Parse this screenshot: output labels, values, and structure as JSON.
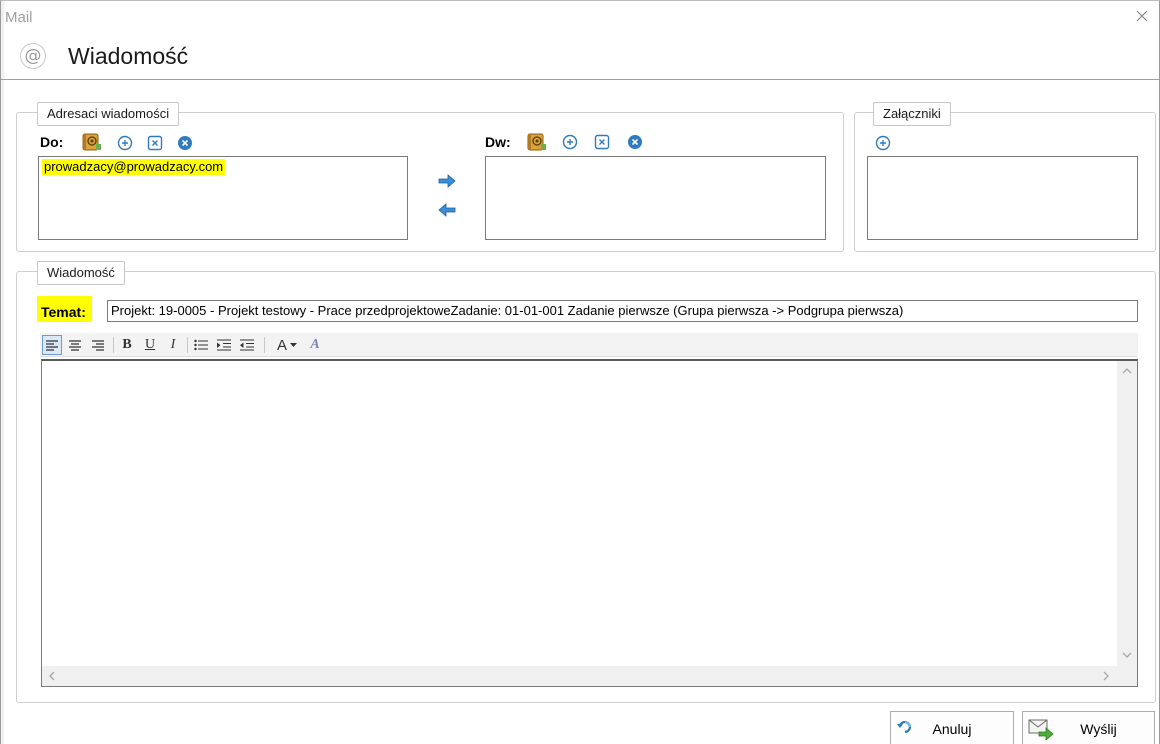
{
  "window": {
    "title": "Mail"
  },
  "header": {
    "title": "Wiadomość",
    "icon": "at-icon"
  },
  "recipients": {
    "legend": "Adresaci wiadomości",
    "to_label": "Do:",
    "to_values": [
      "prowadzacy@prowadzacy.com"
    ],
    "cc_label": "Dw:"
  },
  "attachments": {
    "legend": "Załączniki"
  },
  "message": {
    "legend": "Wiadomość",
    "subject_label": "Temat:",
    "subject_value": "Projekt: 19-0005 - Projekt testowy - Prace przedprojektoweZadanie: 01-01-001 Zadanie pierwsze (Grupa pierwsza -> Podgrupa pierwsza)"
  },
  "toolbar": {
    "bold": "B",
    "underline": "U",
    "italic": "I",
    "font_color": "A",
    "clear_format": "A"
  },
  "footer": {
    "cancel": "Anuluj",
    "send": "Wyślij"
  },
  "colors": {
    "highlight": "#ffff00",
    "icon_blue": "#2f7bbf",
    "address_book": "#d9a43a"
  }
}
